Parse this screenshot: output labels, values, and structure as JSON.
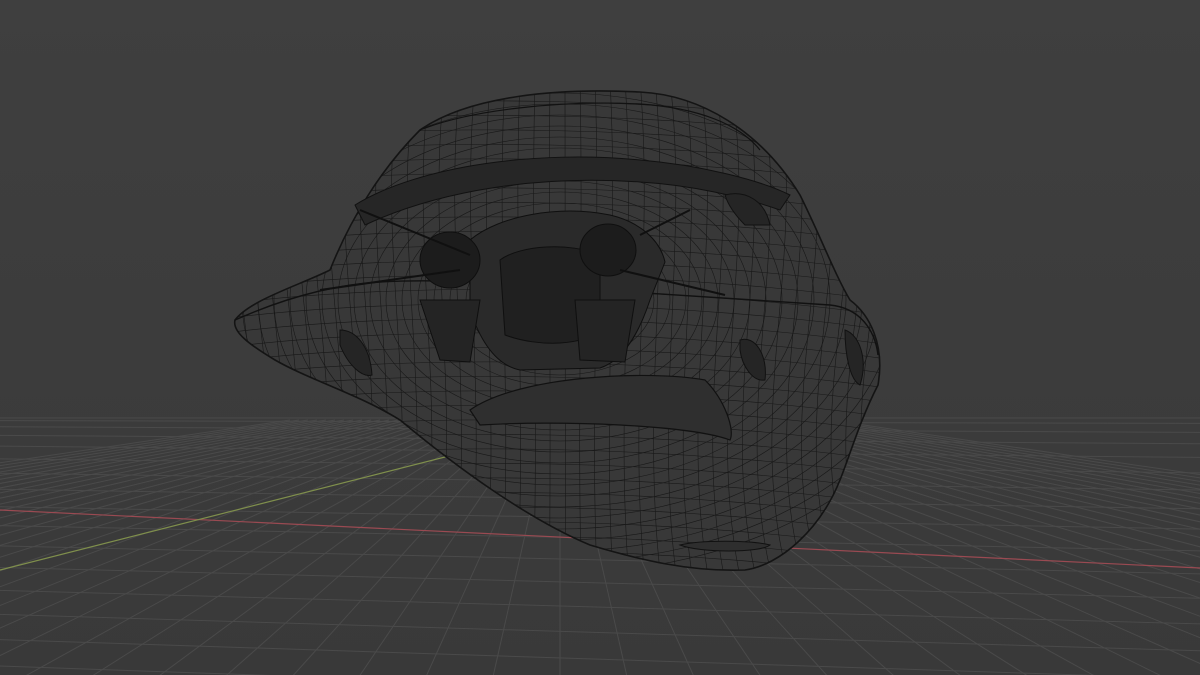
{
  "viewport": {
    "background_color": "#3d3d3d",
    "grid_color": "#4a4a4a",
    "x_axis_color": "#9a4a52",
    "y_axis_color": "#7f8f4c",
    "wire_color": "#141414",
    "display_mode": "wireframe",
    "object": "helmet-mesh"
  }
}
